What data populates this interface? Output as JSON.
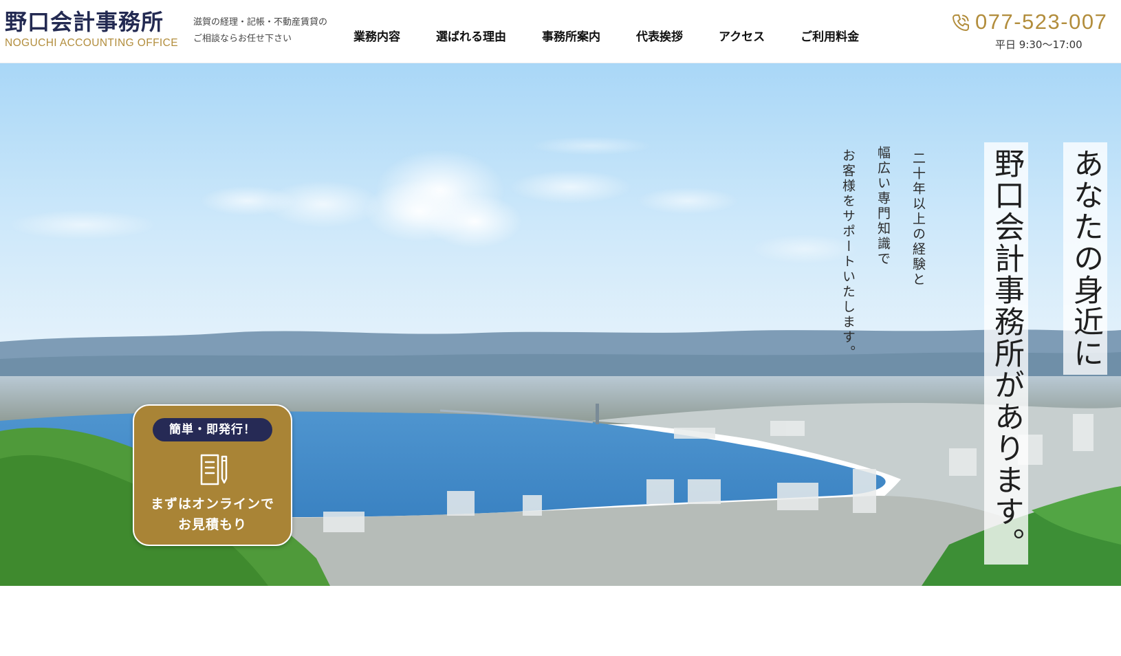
{
  "header": {
    "logo": {
      "name": "野口会計事務所",
      "english": "NOGUCHI ACCOUNTING OFFICE"
    },
    "tagline": {
      "line1": "滋賀の経理・記帳・不動産賃貸の",
      "line2": "ご相談ならお任せ下さい"
    },
    "nav": [
      {
        "label": "業務内容"
      },
      {
        "label": "選ばれる理由"
      },
      {
        "label": "事務所案内"
      },
      {
        "label": "代表挨拶"
      },
      {
        "label": "アクセス"
      },
      {
        "label": "ご利用料金"
      }
    ],
    "phone": {
      "icon": "phone-icon",
      "number": "077-523-007",
      "hours": "平日 9:30〜17:00"
    }
  },
  "hero": {
    "catch_main": "野口会計事務所があります。",
    "catch_top": "あなたの身近に",
    "sub_lines": [
      "二十年以上の経験と",
      "幅広い専門知識で",
      "お客様をサポートいたします。"
    ],
    "estimate": {
      "badge": "簡単・即発行！",
      "icon": "document-pen-icon",
      "line1": "まずはオンラインで",
      "line2": "お見積もり"
    }
  },
  "colors": {
    "brand_navy": "#232a52",
    "brand_gold": "#b28d3c",
    "badge_gold": "#a98436",
    "pill_navy": "#262a55"
  }
}
